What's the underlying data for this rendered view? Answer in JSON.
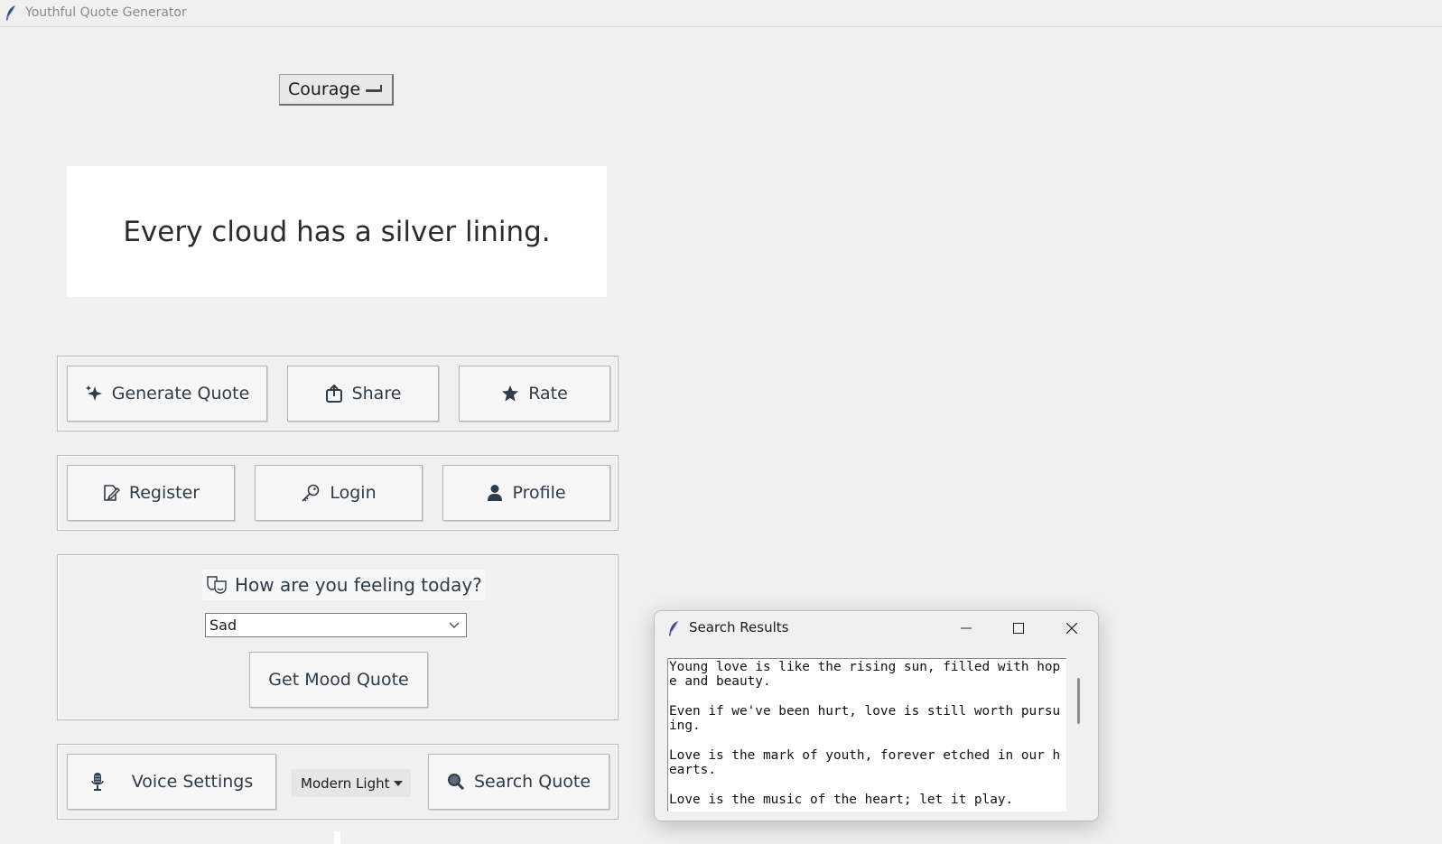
{
  "window": {
    "title": "Youthful Quote Generator"
  },
  "category": {
    "selected": "Courage"
  },
  "quote": {
    "text": "Every cloud has a silver lining."
  },
  "actions": {
    "generate": "Generate Quote",
    "share": "Share",
    "rate": "Rate"
  },
  "account": {
    "register": "Register",
    "login": "Login",
    "profile": "Profile"
  },
  "mood": {
    "label": "How are you feeling today?",
    "selected": "Sad",
    "button": "Get Mood Quote"
  },
  "tools": {
    "voice": "Voice Settings",
    "theme": "Modern Light",
    "search": "Search Quote"
  },
  "search_results": {
    "title": "Search Results",
    "lines": [
      "Young love is like the rising sun, filled with hop",
      "e and beauty.",
      "",
      "Even if we've been hurt, love is still worth pursu",
      "ing.",
      "",
      "Love is the mark of youth, forever etched in our h",
      "earts.",
      "",
      "Love is the music of the heart; let it play."
    ]
  }
}
